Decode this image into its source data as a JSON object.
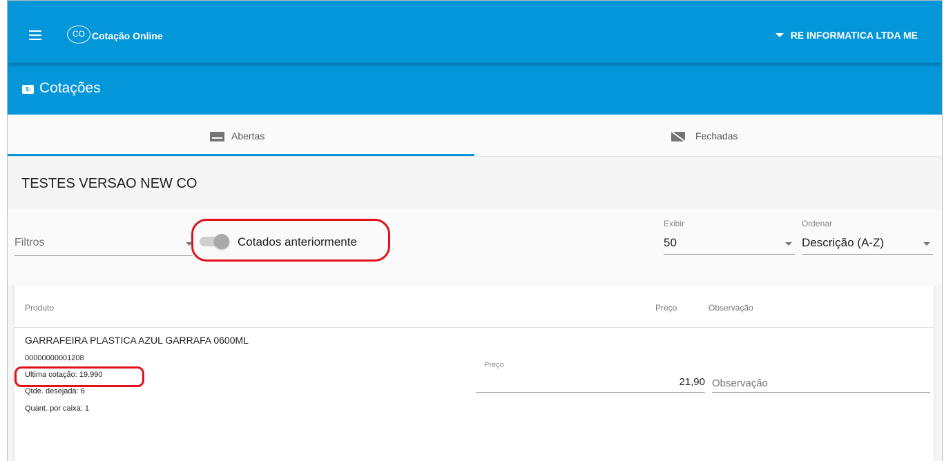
{
  "header": {
    "menu_icon": "menu-icon",
    "logo_text": "CO",
    "app_title": "Cotação Online",
    "company": "RE INFORMATICA LTDA ME",
    "brand_color": "#0396d9"
  },
  "subheader": {
    "icon": "cotacao-icon",
    "title": "Cotações"
  },
  "tabs": [
    {
      "label": "Abertas",
      "icon": "open-quotes-icon",
      "active": true
    },
    {
      "label": "Fechadas",
      "icon": "closed-quotes-icon",
      "active": false
    }
  ],
  "quote": {
    "title": "TESTES VERSAO NEW CO"
  },
  "filters": {
    "filtros_label": "Filtros",
    "switch_label": "Cotados anteriormente",
    "switch_on": false,
    "exibir_label": "Exibir",
    "exibir_value": "50",
    "ordenar_label": "Ordenar",
    "ordenar_value": "Descrição (A-Z)"
  },
  "table": {
    "headers": {
      "produto": "Produto",
      "preco": "Preço",
      "observacao": "Observação"
    },
    "rows": [
      {
        "name": "GARRAFEIRA PLASTICA AZUL GARRAFA 0600ML",
        "code": "00000000001208",
        "ultima_cotacao": "Ultima cotação: 19,990",
        "qtde_desejada": "Qtde. desejada: 6",
        "quant_por_caixa": "Quant. por caixa: 1",
        "preco_label": "Preço",
        "preco_value": "21,90",
        "observacao_placeholder": "Observação"
      }
    ]
  },
  "annotations": {
    "highlight_color": "#e0101a"
  }
}
